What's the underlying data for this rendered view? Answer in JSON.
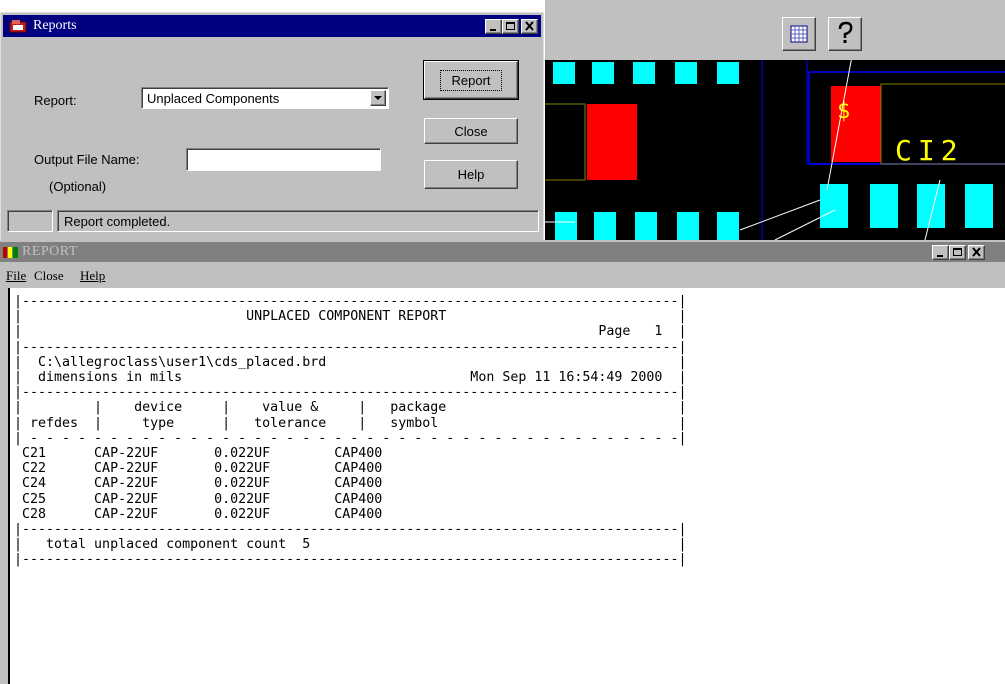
{
  "reports_dialog": {
    "title": "Reports",
    "report_label": "Report:",
    "report_selected": "Unplaced Components",
    "output_label": "Output File Name:",
    "output_value": "",
    "optional_label": "(Optional)",
    "buttons": {
      "report": "Report",
      "close": "Close",
      "help": "Help"
    },
    "status": "Report completed."
  },
  "pcb_view": {
    "silkscreen_text": "CI2"
  },
  "report_window": {
    "title": "REPORT",
    "menu": {
      "file": "File",
      "close": "Close",
      "help": "Help"
    },
    "report": {
      "title": "UNPLACED COMPONENT REPORT",
      "page_label": "Page",
      "page_number": "1",
      "file_path": "C:\\allegroclass\\user1\\cds_placed.brd",
      "units": "dimensions in mils",
      "date": "Mon Sep 11 16:54:49 2000",
      "columns": [
        {
          "line1": "",
          "line2": "refdes"
        },
        {
          "line1": "device",
          "line2": "type"
        },
        {
          "line1": "value &",
          "line2": "tolerance"
        },
        {
          "line1": "package",
          "line2": "symbol"
        }
      ],
      "rows": [
        {
          "refdes": "C21",
          "device": "CAP-22UF",
          "value": "0.022UF",
          "package": "CAP400"
        },
        {
          "refdes": "C22",
          "device": "CAP-22UF",
          "value": "0.022UF",
          "package": "CAP400"
        },
        {
          "refdes": "C24",
          "device": "CAP-22UF",
          "value": "0.022UF",
          "package": "CAP400"
        },
        {
          "refdes": "C25",
          "device": "CAP-22UF",
          "value": "0.022UF",
          "package": "CAP400"
        },
        {
          "refdes": "C28",
          "device": "CAP-22UF",
          "value": "0.022UF",
          "package": "CAP400"
        }
      ],
      "total_label": "total unplaced component count",
      "total_count": "5"
    }
  },
  "colors": {
    "titlebar_active": "#000080",
    "titlebar_inactive": "#808080",
    "pad_cyan": "#00ffff",
    "pad_red": "#ff0000",
    "outline_blue": "#0000ff",
    "silkscreen_yellow": "#ffff00"
  },
  "icons": [
    "reports-app-icon",
    "report-app-icon",
    "minimize-icon",
    "maximize-icon",
    "close-icon",
    "chevron-down-icon",
    "grid-icon",
    "help-question-icon"
  ]
}
